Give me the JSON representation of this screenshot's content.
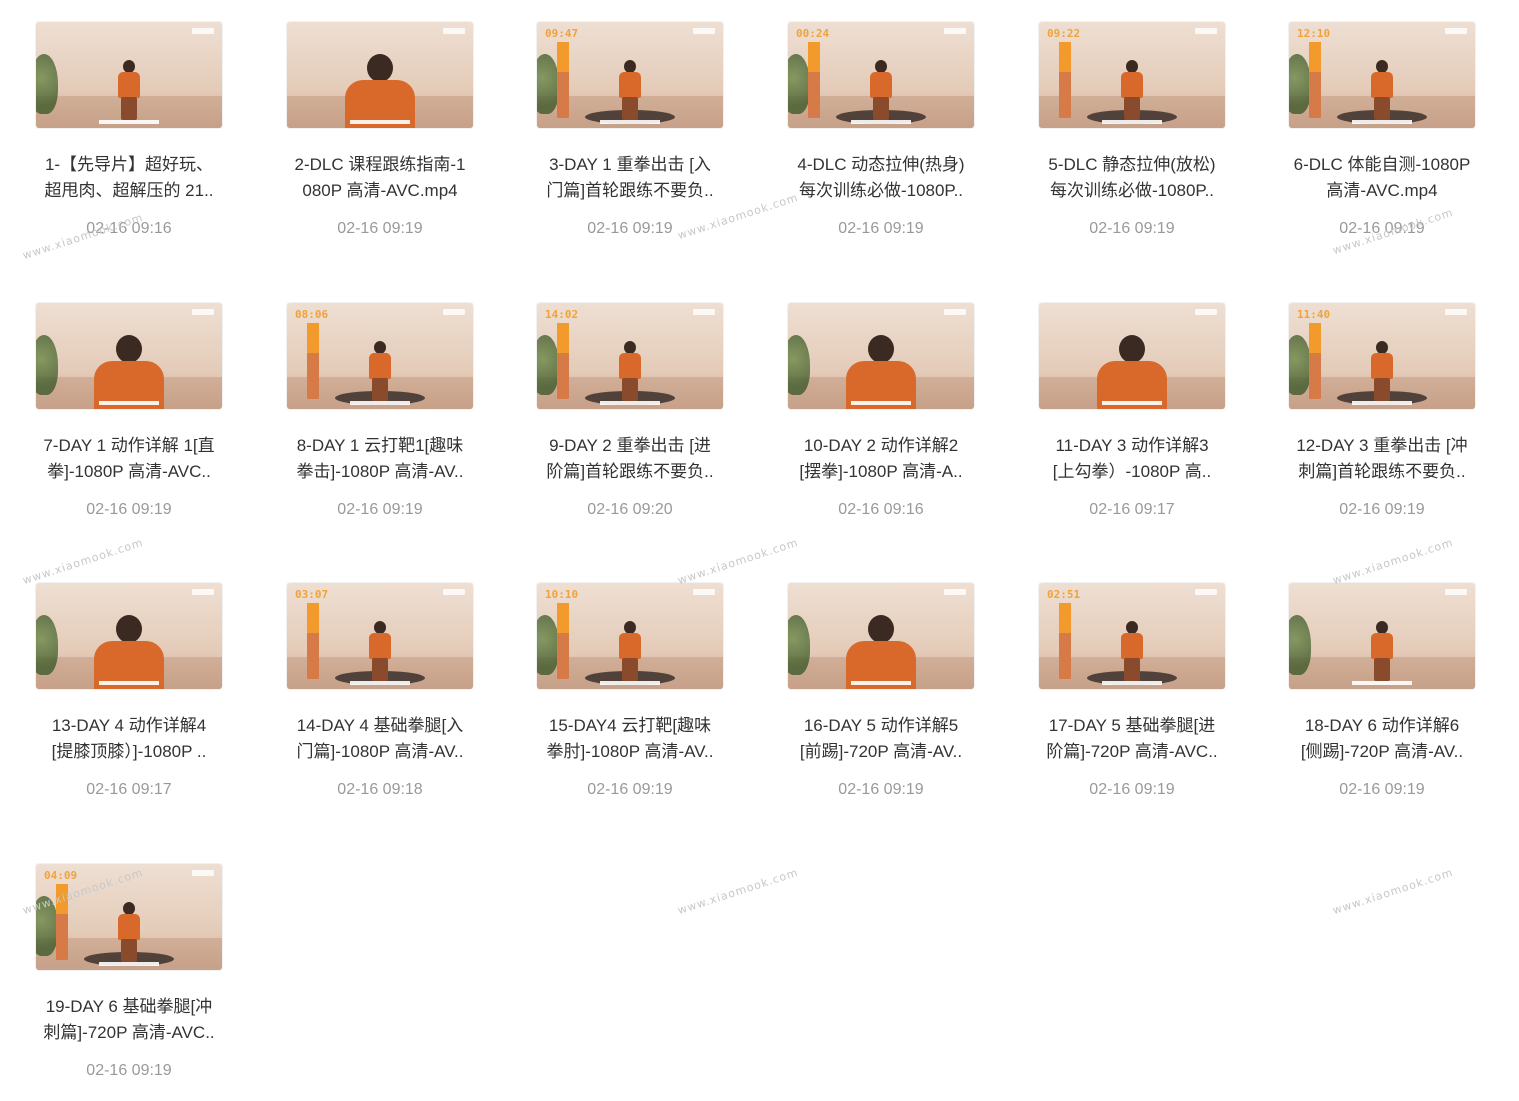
{
  "files": [
    {
      "title": "1-【先导片】超好玩、\n超甩肉、超解压的 21..",
      "date": "02-16 09:16",
      "timer": ""
    },
    {
      "title": "2-DLC 课程跟练指南-1\n080P 高清-AVC.mp4",
      "date": "02-16 09:19",
      "timer": ""
    },
    {
      "title": "3-DAY 1 重拳出击 [入\n门篇]首轮跟练不要负..",
      "date": "02-16 09:19",
      "timer": "09:47"
    },
    {
      "title": "4-DLC 动态拉伸(热身)\n每次训练必做-1080P..",
      "date": "02-16 09:19",
      "timer": "00:24"
    },
    {
      "title": "5-DLC 静态拉伸(放松)\n每次训练必做-1080P..",
      "date": "02-16 09:19",
      "timer": "09:22"
    },
    {
      "title": "6-DLC 体能自测-1080P\n高清-AVC.mp4",
      "date": "02-16 09:19",
      "timer": "12:10"
    },
    {
      "title": "7-DAY 1 动作详解 1[直\n拳]-1080P 高清-AVC..",
      "date": "02-16 09:19",
      "timer": ""
    },
    {
      "title": "8-DAY 1 云打靶1[趣味\n拳击]-1080P 高清-AV..",
      "date": "02-16 09:19",
      "timer": "08:06"
    },
    {
      "title": "9-DAY 2 重拳出击 [进\n阶篇]首轮跟练不要负..",
      "date": "02-16 09:20",
      "timer": "14:02"
    },
    {
      "title": "10-DAY 2 动作详解2\n[摆拳]-1080P 高清-A..",
      "date": "02-16 09:16",
      "timer": ""
    },
    {
      "title": "11-DAY 3 动作详解3\n[上勾拳）-1080P 高..",
      "date": "02-16 09:17",
      "timer": ""
    },
    {
      "title": "12-DAY 3 重拳出击 [冲\n刺篇]首轮跟练不要负..",
      "date": "02-16 09:19",
      "timer": "11:40"
    },
    {
      "title": "13-DAY 4 动作详解4\n[提膝顶膝）]-1080P ..",
      "date": "02-16 09:17",
      "timer": ""
    },
    {
      "title": "14-DAY 4 基础拳腿[入\n门篇]-1080P 高清-AV..",
      "date": "02-16 09:18",
      "timer": "03:07"
    },
    {
      "title": "15-DAY4 云打靶[趣味\n拳肘]-1080P 高清-AV..",
      "date": "02-16 09:19",
      "timer": "10:10"
    },
    {
      "title": "16-DAY 5 动作详解5\n[前踢]-720P 高清-AV..",
      "date": "02-16 09:19",
      "timer": ""
    },
    {
      "title": "17-DAY 5 基础拳腿[进\n阶篇]-720P 高清-AVC..",
      "date": "02-16 09:19",
      "timer": "02:51"
    },
    {
      "title": "18-DAY 6 动作详解6\n[侧踢]-720P 高清-AV..",
      "date": "02-16 09:19",
      "timer": ""
    },
    {
      "title": "19-DAY 6 基础拳腿[冲\n刺篇]-720P 高清-AVC..",
      "date": "02-16 09:19",
      "timer": "04:09"
    }
  ],
  "watermark": "www.xiaomook.com"
}
